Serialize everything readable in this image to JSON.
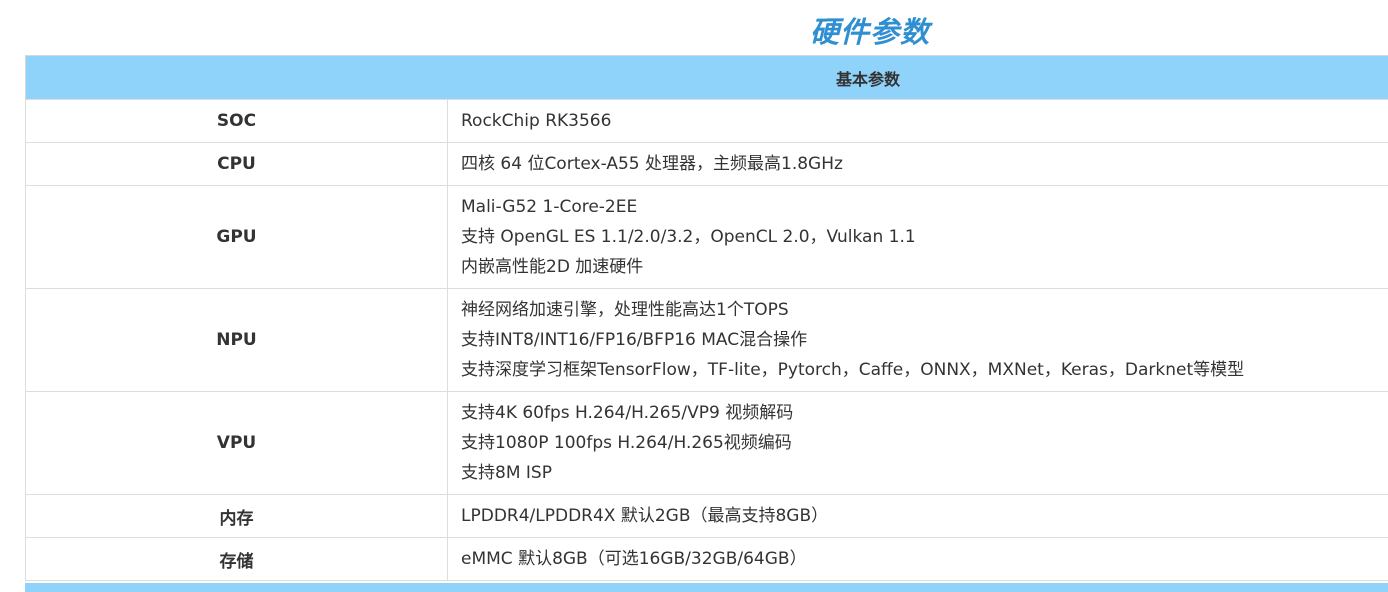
{
  "page_title": "硬件参数",
  "table": {
    "header": "基本参数",
    "rows": [
      {
        "label": "SOC",
        "lines": [
          "RockChip RK3566"
        ]
      },
      {
        "label": "CPU",
        "lines": [
          "四核 64 位Cortex-A55 处理器，主频最高1.8GHz"
        ]
      },
      {
        "label": "GPU",
        "lines": [
          "Mali-G52 1-Core-2EE",
          "支持 OpenGL ES 1.1/2.0/3.2，OpenCL 2.0，Vulkan 1.1",
          "内嵌高性能2D 加速硬件"
        ]
      },
      {
        "label": "NPU",
        "lines": [
          "神经网络加速引擎，处理性能高达1个TOPS",
          "支持INT8/INT16/FP16/BFP16 MAC混合操作",
          "支持深度学习框架TensorFlow，TF-lite，Pytorch，Caffe，ONNX，MXNet，Keras，Darknet等模型"
        ]
      },
      {
        "label": "VPU",
        "lines": [
          "支持4K 60fps H.264/H.265/VP9 视频解码",
          "支持1080P 100fps H.264/H.265视频编码",
          "支持8M ISP"
        ]
      },
      {
        "label": "内存",
        "lines": [
          "LPDDR4/LPDDR4X 默认2GB（最高支持8GB）"
        ]
      },
      {
        "label": "存储",
        "lines": [
          "eMMC 默认8GB（可选16GB/32GB/64GB）"
        ]
      }
    ]
  },
  "colors": {
    "title": "#2f8fd1",
    "header_bg": "#8fd3fb",
    "border": "#dddddd"
  }
}
